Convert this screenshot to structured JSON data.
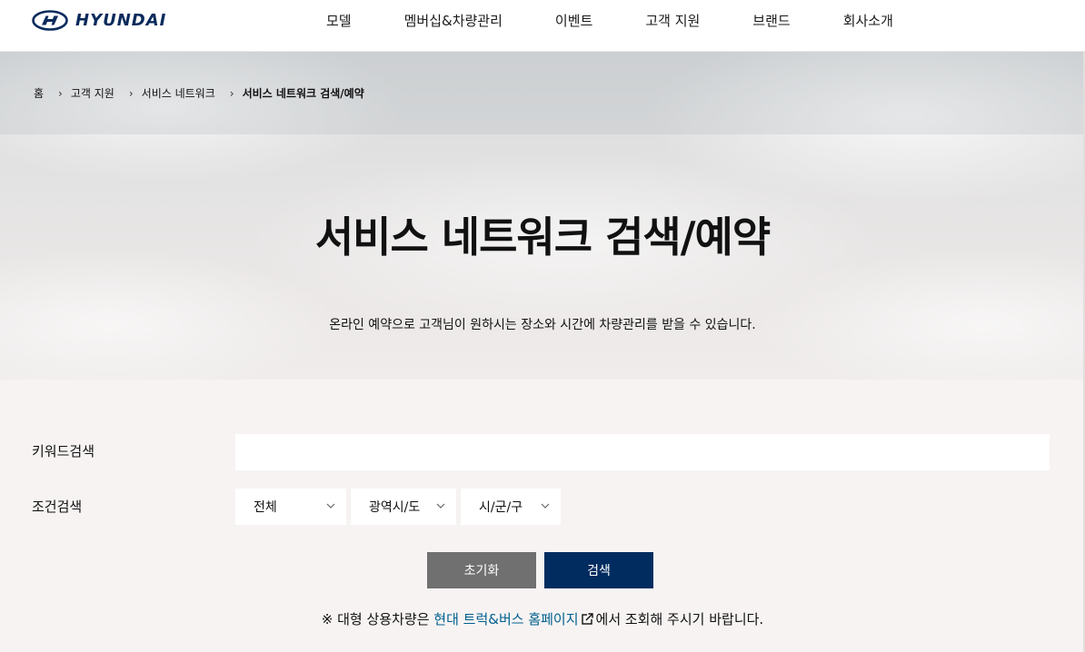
{
  "header": {
    "logo_text": "HYUNDAI",
    "nav": [
      "모델",
      "멤버십&차량관리",
      "이벤트",
      "고객 지원",
      "브랜드",
      "회사소개"
    ]
  },
  "breadcrumb": {
    "home": "홈",
    "items": [
      "고객 지원",
      "서비스 네트워크",
      "서비스 네트워크 검색/예약"
    ]
  },
  "hero": {
    "title": "서비스 네트워크 검색/예약",
    "description": "온라인 예약으로 고객님이 원하시는 장소와 시간에 차량관리를 받을 수 있습니다."
  },
  "search": {
    "keyword_label": "키워드검색",
    "keyword_value": "",
    "condition_label": "조건검색",
    "selects": [
      "전체",
      "광역시/도",
      "시/군/구"
    ],
    "reset_label": "초기화",
    "search_label": "검색"
  },
  "notice": {
    "prefix": "※ 대형 상용차량은 ",
    "link": "현대 트럭&버스 홈페이지",
    "suffix": "에서 조회해 주시기 바랍니다."
  },
  "colors": {
    "brand_navy": "#002c5f",
    "reset_gray": "#707070",
    "link_blue": "#005f8f",
    "page_bg": "#f6f3f2"
  }
}
